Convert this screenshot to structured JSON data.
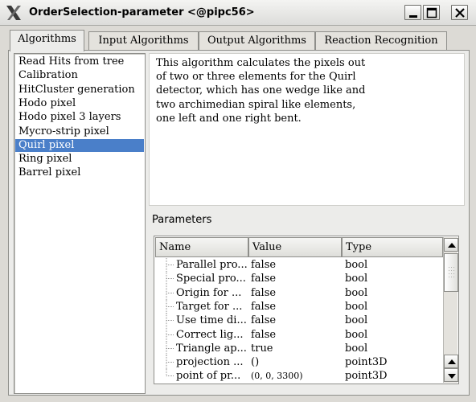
{
  "window": {
    "title": "OrderSelection-parameter <@pipc56>"
  },
  "tabs": [
    {
      "label": "Algorithms",
      "active": true
    },
    {
      "label": "Input Algorithms",
      "active": false
    },
    {
      "label": "Output Algorithms",
      "active": false
    },
    {
      "label": "Reaction Recognition",
      "active": false
    }
  ],
  "algorithms": {
    "items": [
      "Read Hits from tree",
      "Calibration",
      "HitCluster generation",
      "Hodo pixel",
      "Hodo pixel 3 layers",
      "Mycro-strip pixel",
      "Quirl pixel",
      "Ring pixel",
      "Barrel pixel"
    ],
    "selected": "Quirl pixel"
  },
  "description": {
    "text": "This algorithm calculates the pixels out of two or three elements for the Quirl detector, which has one wedge like and two archimedian spiral like elements, one left and one right bent."
  },
  "parameters": {
    "label": "Parameters",
    "columns": [
      "Name",
      "Value",
      "Type"
    ],
    "rows": [
      {
        "name": "Parallel pro...",
        "value": "false",
        "type": "bool"
      },
      {
        "name": "Special pro...",
        "value": "false",
        "type": "bool"
      },
      {
        "name": "Origin for ...",
        "value": "false",
        "type": "bool"
      },
      {
        "name": "Target for ...",
        "value": "false",
        "type": "bool"
      },
      {
        "name": "Use time di...",
        "value": "false",
        "type": "bool"
      },
      {
        "name": "Correct lig...",
        "value": "false",
        "type": "bool"
      },
      {
        "name": "Triangle ap...",
        "value": "true",
        "type": "bool"
      },
      {
        "name": "projection ...",
        "value": "()",
        "type": "point3D"
      },
      {
        "name": "point of pr...",
        "value": "(0, 0, 3300)",
        "type": "point3D"
      }
    ]
  },
  "icons": {
    "app": "x-logo-icon",
    "minimize": "minimize-icon",
    "maximize": "maximize-icon",
    "close": "close-icon",
    "scroll_up": "arrow-up-icon",
    "scroll_down": "arrow-down-icon"
  },
  "colors": {
    "selection": "#4a7fc9",
    "window_bg": "#dcdad5"
  }
}
